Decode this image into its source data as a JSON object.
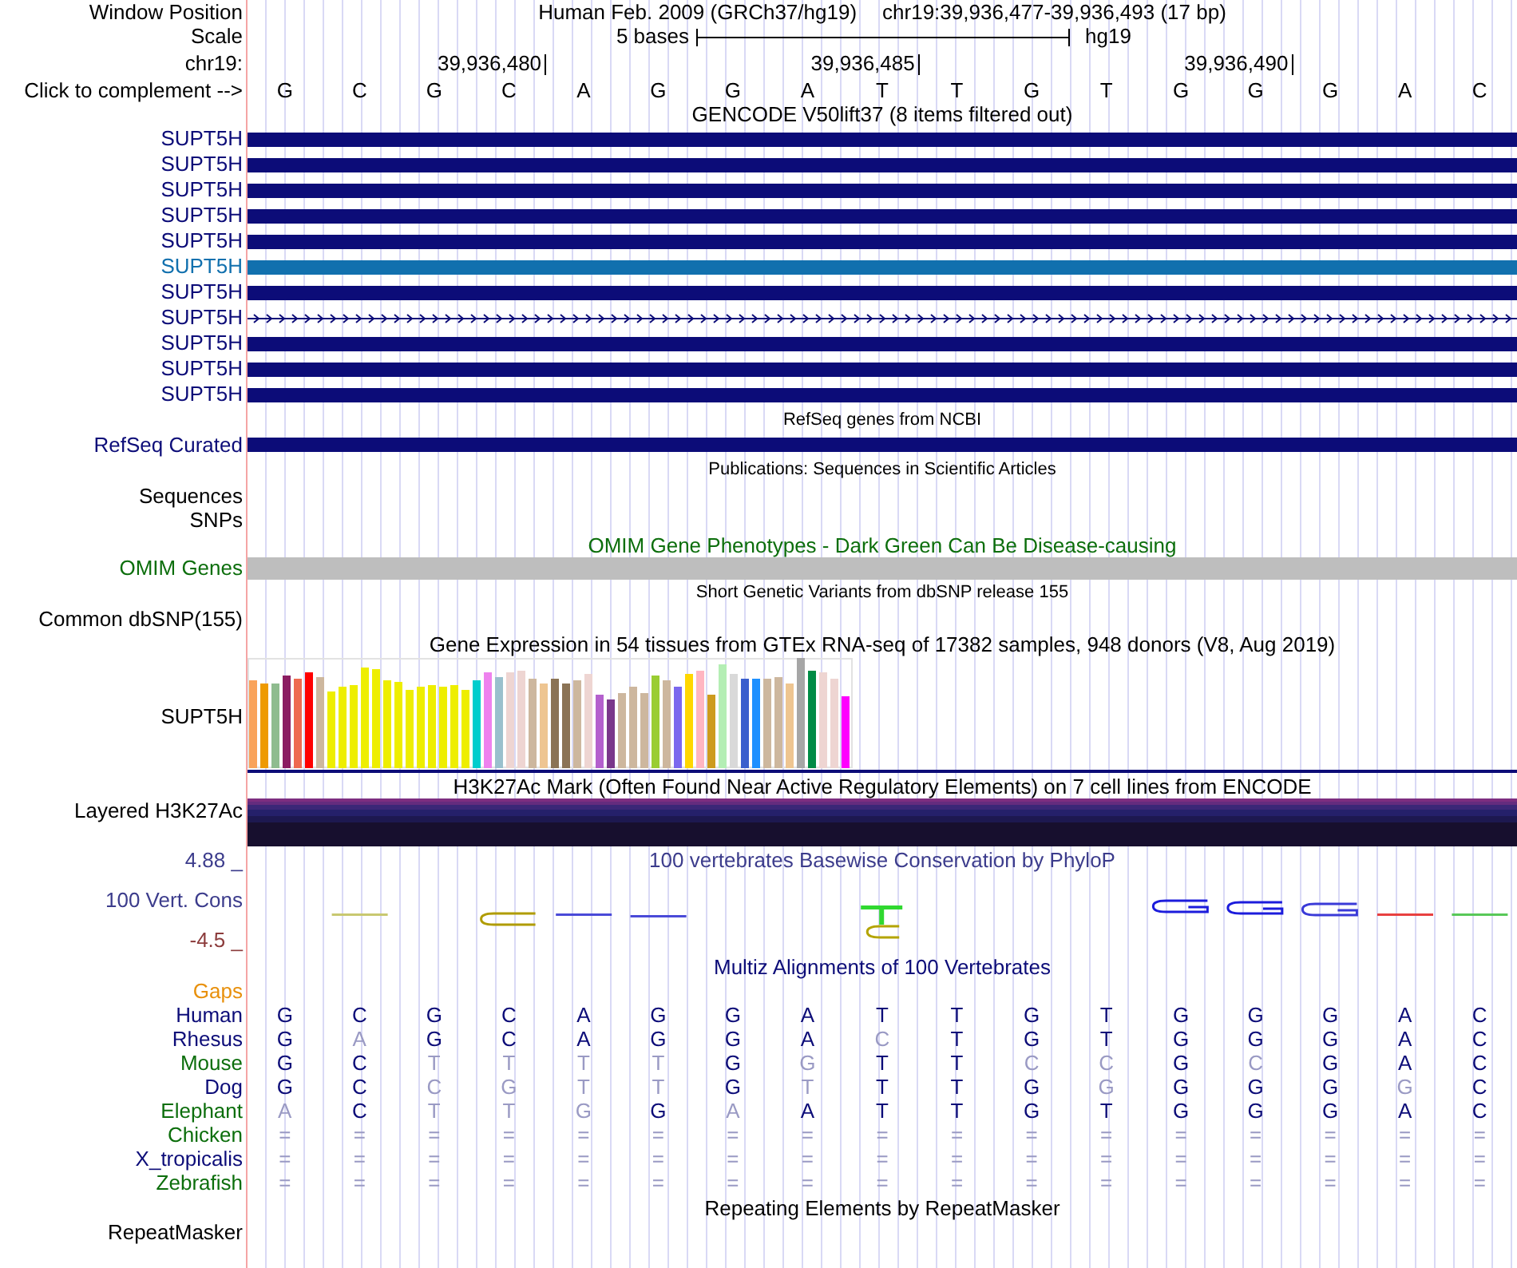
{
  "header": {
    "window_position": {
      "label": "Window Position",
      "assembly": "Human Feb. 2009 (GRCh37/hg19)",
      "position": "chr19:39,936,477-39,936,493 (17 bp)"
    },
    "scale": {
      "label": "Scale",
      "length": "5 bases",
      "assembly": "hg19"
    },
    "ruler": {
      "label": "chr19:",
      "ticks": [
        "39,936,480",
        "39,936,485",
        "39,936,490"
      ]
    },
    "sequence": {
      "label": "Click to complement -->",
      "bases": [
        "G",
        "C",
        "G",
        "C",
        "A",
        "G",
        "G",
        "A",
        "T",
        "T",
        "G",
        "T",
        "G",
        "G",
        "G",
        "A",
        "C"
      ]
    }
  },
  "tracks": [
    {
      "kind": "genes",
      "title": "GENCODE V50lift37 (8 items filtered out)",
      "color": "#000000",
      "rows": [
        {
          "label": "SUPT5H",
          "kind": "exon",
          "color": "#0c0c78"
        },
        {
          "label": "SUPT5H",
          "kind": "exon",
          "color": "#0c0c78"
        },
        {
          "label": "SUPT5H",
          "kind": "exon",
          "color": "#0c0c78"
        },
        {
          "label": "SUPT5H",
          "kind": "exon",
          "color": "#0c0c78"
        },
        {
          "label": "SUPT5H",
          "kind": "exon",
          "color": "#0c0c78"
        },
        {
          "label": "SUPT5H",
          "kind": "exon",
          "color": "#1170ae"
        },
        {
          "label": "SUPT5H",
          "kind": "exon",
          "color": "#0c0c78"
        },
        {
          "label": "SUPT5H",
          "kind": "intron",
          "color": "#0c0c78"
        },
        {
          "label": "SUPT5H",
          "kind": "exon",
          "color": "#0c0c78"
        },
        {
          "label": "SUPT5H",
          "kind": "exon",
          "color": "#0c0c78"
        },
        {
          "label": "SUPT5H",
          "kind": "exon",
          "color": "#0c0c78"
        }
      ]
    },
    {
      "kind": "refseq",
      "title": "RefSeq genes from NCBI",
      "color": "#000000",
      "rows": [
        {
          "label": "RefSeq Curated",
          "kind": "exon",
          "color": "#0c0c78"
        }
      ]
    },
    {
      "kind": "publications",
      "title": "Publications: Sequences in Scientific Articles",
      "color": "#000000",
      "labels": [
        "Sequences",
        "SNPs"
      ]
    },
    {
      "kind": "dense",
      "title": "OMIM Gene Phenotypes - Dark Green Can Be Disease-causing",
      "color": "#0c6e0c",
      "rows": [
        {
          "label": "OMIM Genes",
          "color": "#bebebe"
        }
      ]
    },
    {
      "kind": "variants",
      "title": "Short Genetic Variants from dbSNP release 155",
      "color": "#000000",
      "labels": [
        "Common dbSNP(155)"
      ]
    },
    {
      "kind": "expression",
      "title": "Gene Expression in 54 tissues from GTEx RNA-seq of 17382 samples, 948 donors (V8, Aug 2019)",
      "color": "#000000",
      "label": "SUPT5H"
    },
    {
      "kind": "layered_signal",
      "title": "H3K27Ac Mark (Often Found Near Active Regulatory Elements) on 7 cell lines from ENCODE",
      "color": "#000000",
      "label": "Layered H3K27Ac"
    },
    {
      "kind": "conservation",
      "title": "100 vertebrates Basewise Conservation by PhyloP",
      "color": "#3c3c8c",
      "label": "100 Vert. Cons",
      "max": {
        "text": "4.88 _",
        "color": "#3c3c8c"
      },
      "min": {
        "text": "-4.5 _",
        "color": "#8c3c3c"
      }
    },
    {
      "kind": "alignment",
      "title": "Multiz Alignments of 100 Vertebrates",
      "color": "#0c0c78",
      "gaps": {
        "label": "Gaps",
        "color": "#e8900c"
      },
      "species": [
        {
          "name": "Human",
          "color": "#0c0c78",
          "bases": [
            {
              "base": "G",
              "match": true
            },
            {
              "base": "C",
              "match": true
            },
            {
              "base": "G",
              "match": true
            },
            {
              "base": "C",
              "match": true
            },
            {
              "base": "A",
              "match": true
            },
            {
              "base": "G",
              "match": true
            },
            {
              "base": "G",
              "match": true
            },
            {
              "base": "A",
              "match": true
            },
            {
              "base": "T",
              "match": true
            },
            {
              "base": "T",
              "match": true
            },
            {
              "base": "G",
              "match": true
            },
            {
              "base": "T",
              "match": true
            },
            {
              "base": "G",
              "match": true
            },
            {
              "base": "G",
              "match": true
            },
            {
              "base": "G",
              "match": true
            },
            {
              "base": "A",
              "match": true
            },
            {
              "base": "C",
              "match": true
            }
          ]
        },
        {
          "name": "Rhesus",
          "color": "#0c0c78",
          "bases": [
            {
              "base": "G",
              "match": true
            },
            {
              "base": "A",
              "match": false
            },
            {
              "base": "G",
              "match": true
            },
            {
              "base": "C",
              "match": true
            },
            {
              "base": "A",
              "match": true
            },
            {
              "base": "G",
              "match": true
            },
            {
              "base": "G",
              "match": true
            },
            {
              "base": "A",
              "match": true
            },
            {
              "base": "C",
              "match": false
            },
            {
              "base": "T",
              "match": true
            },
            {
              "base": "G",
              "match": true
            },
            {
              "base": "T",
              "match": true
            },
            {
              "base": "G",
              "match": true
            },
            {
              "base": "G",
              "match": true
            },
            {
              "base": "G",
              "match": true
            },
            {
              "base": "A",
              "match": true
            },
            {
              "base": "C",
              "match": true
            }
          ]
        },
        {
          "name": "Mouse",
          "color": "#0c6e0c",
          "bases": [
            {
              "base": "G",
              "match": true
            },
            {
              "base": "C",
              "match": true
            },
            {
              "base": "T",
              "match": false
            },
            {
              "base": "T",
              "match": false
            },
            {
              "base": "T",
              "match": false
            },
            {
              "base": "T",
              "match": false
            },
            {
              "base": "G",
              "match": true
            },
            {
              "base": "G",
              "match": false
            },
            {
              "base": "T",
              "match": true
            },
            {
              "base": "T",
              "match": true
            },
            {
              "base": "C",
              "match": false
            },
            {
              "base": "C",
              "match": false
            },
            {
              "base": "G",
              "match": true
            },
            {
              "base": "C",
              "match": false
            },
            {
              "base": "G",
              "match": true
            },
            {
              "base": "A",
              "match": true
            },
            {
              "base": "C",
              "match": true
            }
          ]
        },
        {
          "name": "Dog",
          "color": "#0c0c78",
          "bases": [
            {
              "base": "G",
              "match": true
            },
            {
              "base": "C",
              "match": true
            },
            {
              "base": "C",
              "match": false
            },
            {
              "base": "G",
              "match": false
            },
            {
              "base": "T",
              "match": false
            },
            {
              "base": "T",
              "match": false
            },
            {
              "base": "G",
              "match": true
            },
            {
              "base": "T",
              "match": false
            },
            {
              "base": "T",
              "match": true
            },
            {
              "base": "T",
              "match": true
            },
            {
              "base": "G",
              "match": true
            },
            {
              "base": "G",
              "match": false
            },
            {
              "base": "G",
              "match": true
            },
            {
              "base": "G",
              "match": true
            },
            {
              "base": "G",
              "match": true
            },
            {
              "base": "G",
              "match": false
            },
            {
              "base": "C",
              "match": true
            }
          ]
        },
        {
          "name": "Elephant",
          "color": "#0c6e0c",
          "bases": [
            {
              "base": "A",
              "match": false
            },
            {
              "base": "C",
              "match": true
            },
            {
              "base": "T",
              "match": false
            },
            {
              "base": "T",
              "match": false
            },
            {
              "base": "G",
              "match": false
            },
            {
              "base": "G",
              "match": true
            },
            {
              "base": "A",
              "match": false
            },
            {
              "base": "A",
              "match": true
            },
            {
              "base": "T",
              "match": true
            },
            {
              "base": "T",
              "match": true
            },
            {
              "base": "G",
              "match": true
            },
            {
              "base": "T",
              "match": true
            },
            {
              "base": "G",
              "match": true
            },
            {
              "base": "G",
              "match": true
            },
            {
              "base": "G",
              "match": true
            },
            {
              "base": "A",
              "match": true
            },
            {
              "base": "C",
              "match": true
            }
          ]
        },
        {
          "name": "Chicken",
          "color": "#0c6e0c",
          "bases": [
            {
              "base": "=",
              "match": false
            },
            {
              "base": "=",
              "match": false
            },
            {
              "base": "=",
              "match": false
            },
            {
              "base": "=",
              "match": false
            },
            {
              "base": "=",
              "match": false
            },
            {
              "base": "=",
              "match": false
            },
            {
              "base": "=",
              "match": false
            },
            {
              "base": "=",
              "match": false
            },
            {
              "base": "=",
              "match": false
            },
            {
              "base": "=",
              "match": false
            },
            {
              "base": "=",
              "match": false
            },
            {
              "base": "=",
              "match": false
            },
            {
              "base": "=",
              "match": false
            },
            {
              "base": "=",
              "match": false
            },
            {
              "base": "=",
              "match": false
            },
            {
              "base": "=",
              "match": false
            },
            {
              "base": "=",
              "match": false
            }
          ]
        },
        {
          "name": "X_tropicalis",
          "color": "#0c0c78",
          "bases": [
            {
              "base": "=",
              "match": false
            },
            {
              "base": "=",
              "match": false
            },
            {
              "base": "=",
              "match": false
            },
            {
              "base": "=",
              "match": false
            },
            {
              "base": "=",
              "match": false
            },
            {
              "base": "=",
              "match": false
            },
            {
              "base": "=",
              "match": false
            },
            {
              "base": "=",
              "match": false
            },
            {
              "base": "=",
              "match": false
            },
            {
              "base": "=",
              "match": false
            },
            {
              "base": "=",
              "match": false
            },
            {
              "base": "=",
              "match": false
            },
            {
              "base": "=",
              "match": false
            },
            {
              "base": "=",
              "match": false
            },
            {
              "base": "=",
              "match": false
            },
            {
              "base": "=",
              "match": false
            },
            {
              "base": "=",
              "match": false
            }
          ]
        },
        {
          "name": "Zebrafish",
          "color": "#0c6e0c",
          "bases": [
            {
              "base": "=",
              "match": false
            },
            {
              "base": "=",
              "match": false
            },
            {
              "base": "=",
              "match": false
            },
            {
              "base": "=",
              "match": false
            },
            {
              "base": "=",
              "match": false
            },
            {
              "base": "=",
              "match": false
            },
            {
              "base": "=",
              "match": false
            },
            {
              "base": "=",
              "match": false
            },
            {
              "base": "=",
              "match": false
            },
            {
              "base": "=",
              "match": false
            },
            {
              "base": "=",
              "match": false
            },
            {
              "base": "=",
              "match": false
            },
            {
              "base": "=",
              "match": false
            },
            {
              "base": "=",
              "match": false
            },
            {
              "base": "=",
              "match": false
            },
            {
              "base": "=",
              "match": false
            },
            {
              "base": "=",
              "match": false
            }
          ]
        }
      ]
    },
    {
      "kind": "repeats",
      "title": "Repeating Elements by RepeatMasker",
      "color": "#000000",
      "labels": [
        "RepeatMasker"
      ]
    }
  ]
}
